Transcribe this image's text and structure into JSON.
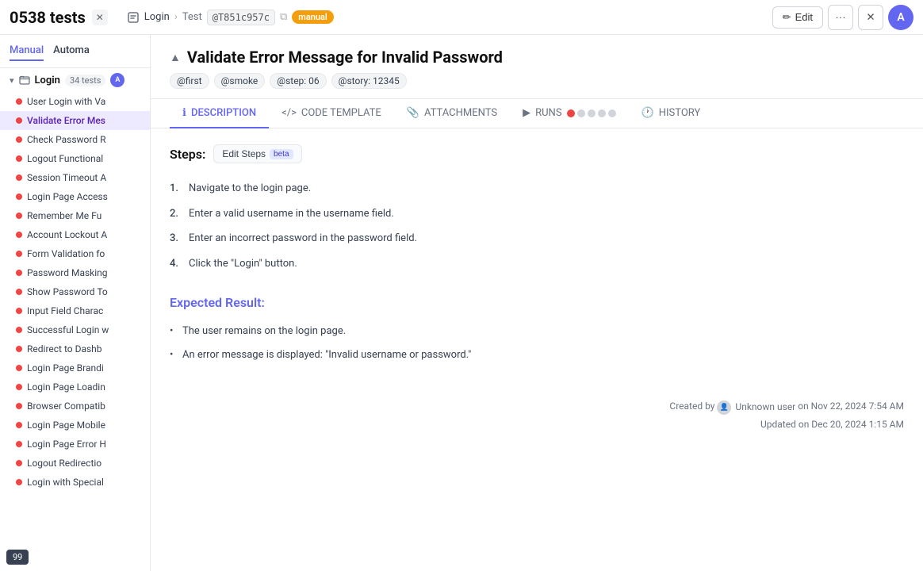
{
  "topbar": {
    "test_count": "0538 tests",
    "breadcrumb": {
      "login": "Login",
      "separator": "›",
      "test_label": "Test",
      "test_id": "@T851c957c"
    },
    "badge_manual": "manual",
    "edit_button": "Edit",
    "avatar_letter": "A"
  },
  "sidebar": {
    "tabs": [
      {
        "label": "Manual",
        "active": true
      },
      {
        "label": "Automa"
      }
    ],
    "folder": {
      "label": "Login",
      "count": "34 tests",
      "avatar": "A"
    },
    "items": [
      {
        "label": "User Login with Va",
        "active": false
      },
      {
        "label": "Validate Error Mes",
        "active": true
      },
      {
        "label": "Check Password R",
        "active": false
      },
      {
        "label": "Logout Functional",
        "active": false
      },
      {
        "label": "Session Timeout A",
        "active": false
      },
      {
        "label": "Login Page Access",
        "active": false
      },
      {
        "label": "Remember Me Fu",
        "active": false
      },
      {
        "label": "Account Lockout A",
        "active": false
      },
      {
        "label": "Form Validation fo",
        "active": false
      },
      {
        "label": "Password Masking",
        "active": false
      },
      {
        "label": "Show Password To",
        "active": false
      },
      {
        "label": "Input Field Charac",
        "active": false
      },
      {
        "label": "Successful Login w",
        "active": false
      },
      {
        "label": "Redirect to Dashb",
        "active": false
      },
      {
        "label": "Login Page Brandi",
        "active": false
      },
      {
        "label": "Login Page Loadin",
        "active": false
      },
      {
        "label": "Browser Compatib",
        "active": false
      },
      {
        "label": "Login Page Mobile",
        "active": false
      },
      {
        "label": "Login Page Error H",
        "active": false
      },
      {
        "label": "Logout Redirectio",
        "active": false
      },
      {
        "label": "Login with Special",
        "active": false
      }
    ]
  },
  "main": {
    "test_title": "Validate Error Message for Invalid Password",
    "tags": [
      "@first",
      "@smoke",
      "@step: 06",
      "@story: 12345"
    ],
    "tabs": [
      {
        "label": "DESCRIPTION",
        "active": true,
        "icon": "ℹ"
      },
      {
        "label": "CODE TEMPLATE",
        "active": false,
        "icon": "<>"
      },
      {
        "label": "ATTACHMENTS",
        "active": false,
        "icon": "📎"
      },
      {
        "label": "RUNS",
        "active": false,
        "icon": "▶"
      },
      {
        "label": "HISTORY",
        "active": false,
        "icon": "🕐"
      }
    ],
    "description": {
      "steps_label": "Steps:",
      "edit_steps_label": "Edit Steps",
      "beta_label": "beta",
      "steps": [
        "Navigate to the login page.",
        "Enter a valid username in the username field.",
        "Enter an incorrect password in the password field.",
        "Click the \"Login\" button."
      ],
      "expected_result_label": "Expected Result:",
      "expected_items": [
        "The user remains on the login page.",
        "An error message is displayed: \"Invalid username or password.\""
      ]
    },
    "meta": {
      "created_label": "Created by",
      "created_user": "Unknown user",
      "created_date": "on Nov 22, 2024 7:54 AM",
      "updated_label": "Updated",
      "updated_date": "on Dec 20, 2024 1:15 AM"
    }
  },
  "bottom": {
    "badge": "99"
  }
}
